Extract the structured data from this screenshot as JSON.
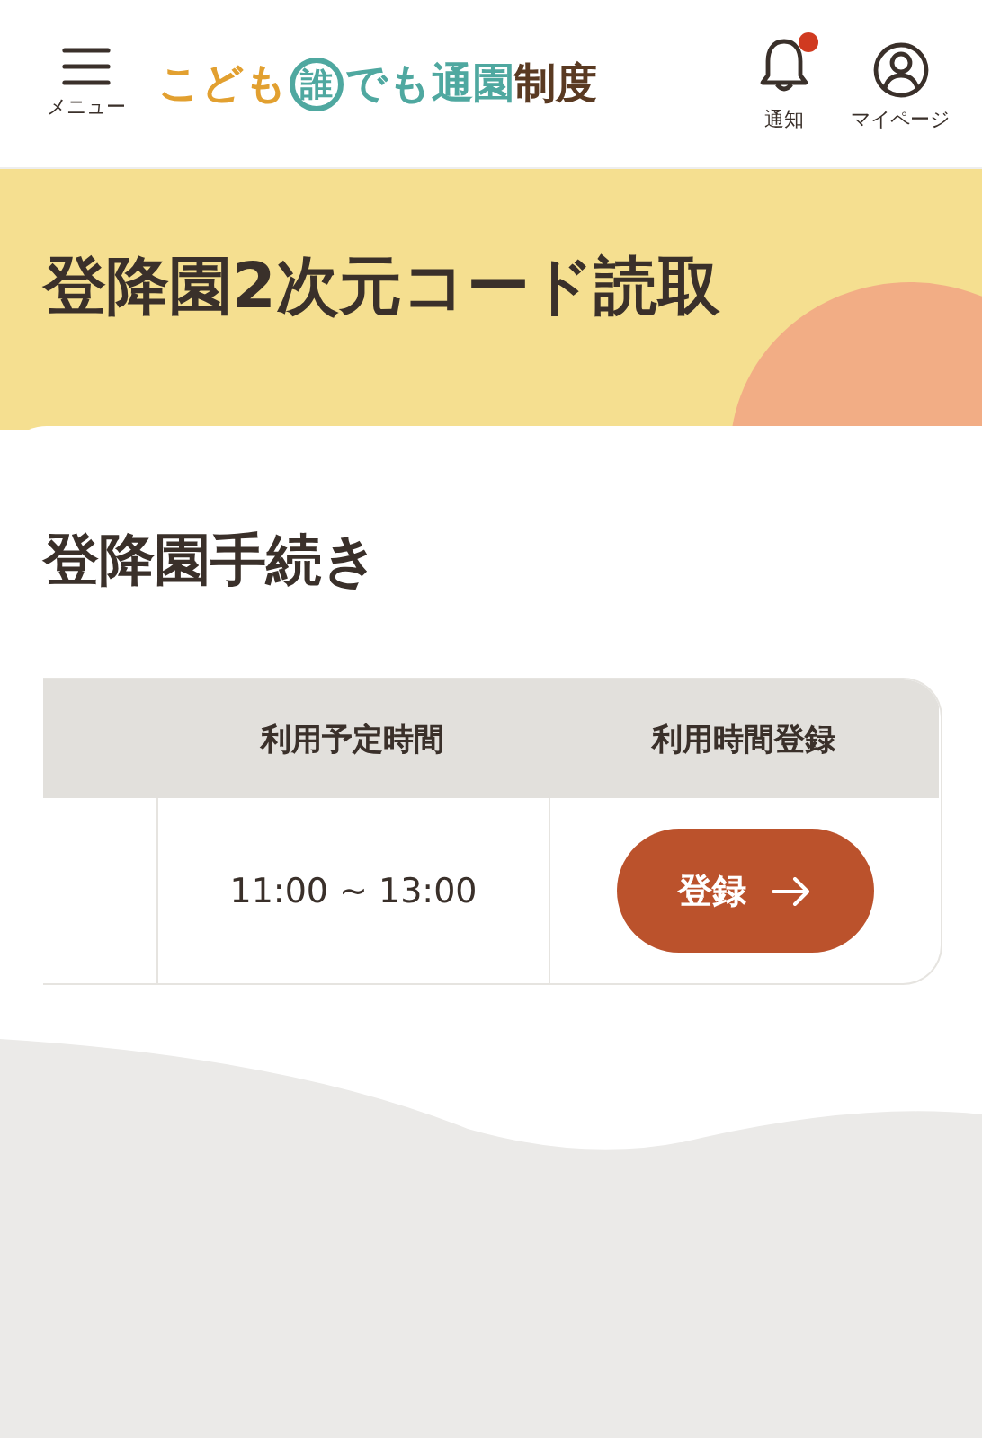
{
  "header": {
    "menu_label": "メニュー",
    "logo": [
      {
        "text": "こども",
        "color": "#e2a030",
        "kind": "plain"
      },
      {
        "text": "誰",
        "color": "#4fa8a0",
        "kind": "circled"
      },
      {
        "text": "でも通園",
        "color": "#4fa8a0",
        "kind": "plain"
      },
      {
        "text": "制度",
        "color": "#5a3a22",
        "kind": "plain"
      }
    ],
    "notification": {
      "label": "通知",
      "unread": true
    },
    "mypage_label": "マイページ"
  },
  "page_title": "登降園2次元コード読取",
  "section_title": "登降園手続き",
  "table": {
    "columns": [
      "利用予定時間",
      "利用時間登録"
    ],
    "rows": [
      {
        "time": "11:00 ~ 13:00",
        "button": "登録"
      }
    ]
  }
}
